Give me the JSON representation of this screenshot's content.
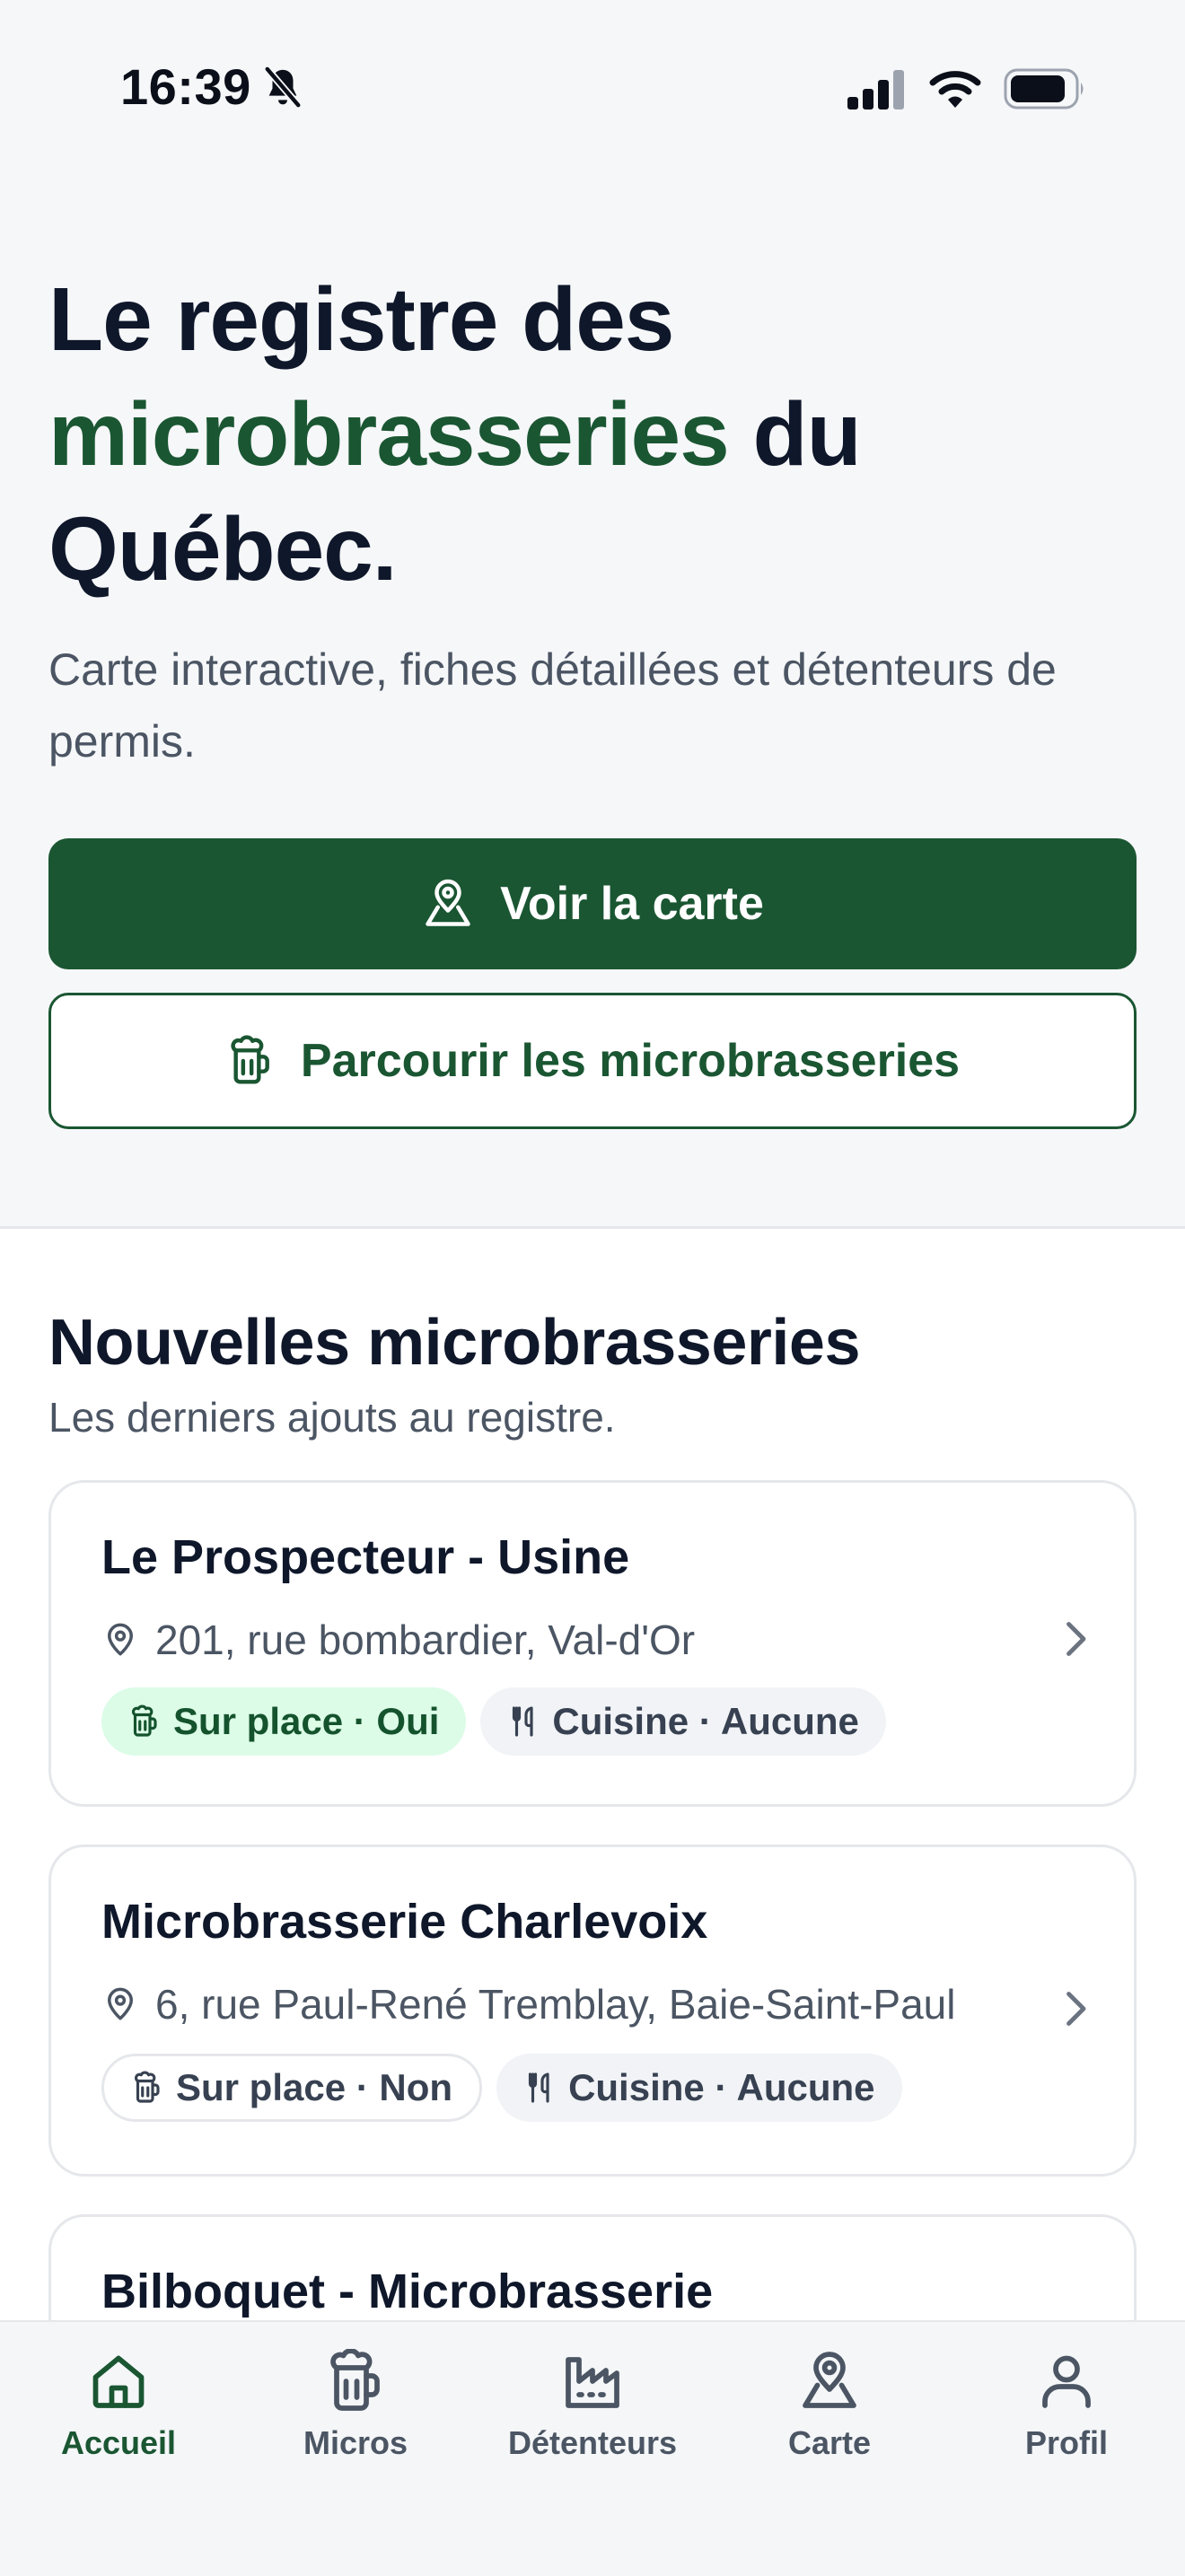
{
  "status_bar": {
    "time": "16:39"
  },
  "hero": {
    "title_part1": "Le registre des ",
    "title_accent": "microbrasseries",
    "title_part2": " du Québec.",
    "subtitle": "Carte interactive, fiches détaillées et détenteurs de permis.",
    "primary_button": "Voir la carte",
    "secondary_button": "Parcourir les microbrasseries"
  },
  "section": {
    "title": "Nouvelles microbrasseries",
    "subtitle": "Les derniers ajouts au registre."
  },
  "breweries": [
    {
      "name": "Le Prospecteur - Usine",
      "address": "201, rue bombardier, Val-d'Or",
      "onsite": "Sur place · Oui",
      "cuisine": "Cuisine · Aucune"
    },
    {
      "name": "Microbrasserie Charlevoix",
      "address": "6, rue Paul-René Tremblay, Baie-Saint-Paul",
      "onsite": "Sur place · Non",
      "cuisine": "Cuisine · Aucune"
    },
    {
      "name": "Bilboquet - Microbrasserie"
    }
  ],
  "tabs": [
    {
      "label": "Accueil",
      "icon": "home-icon"
    },
    {
      "label": "Micros",
      "icon": "beer-mug-icon"
    },
    {
      "label": "Détenteurs",
      "icon": "factory-icon"
    },
    {
      "label": "Carte",
      "icon": "map-pin-icon"
    },
    {
      "label": "Profil",
      "icon": "user-icon"
    }
  ],
  "colors": {
    "accent": "#1a5632",
    "chip_green_bg": "#dcfce7",
    "text_dark": "#0f172a",
    "text_muted": "#4b5563"
  }
}
